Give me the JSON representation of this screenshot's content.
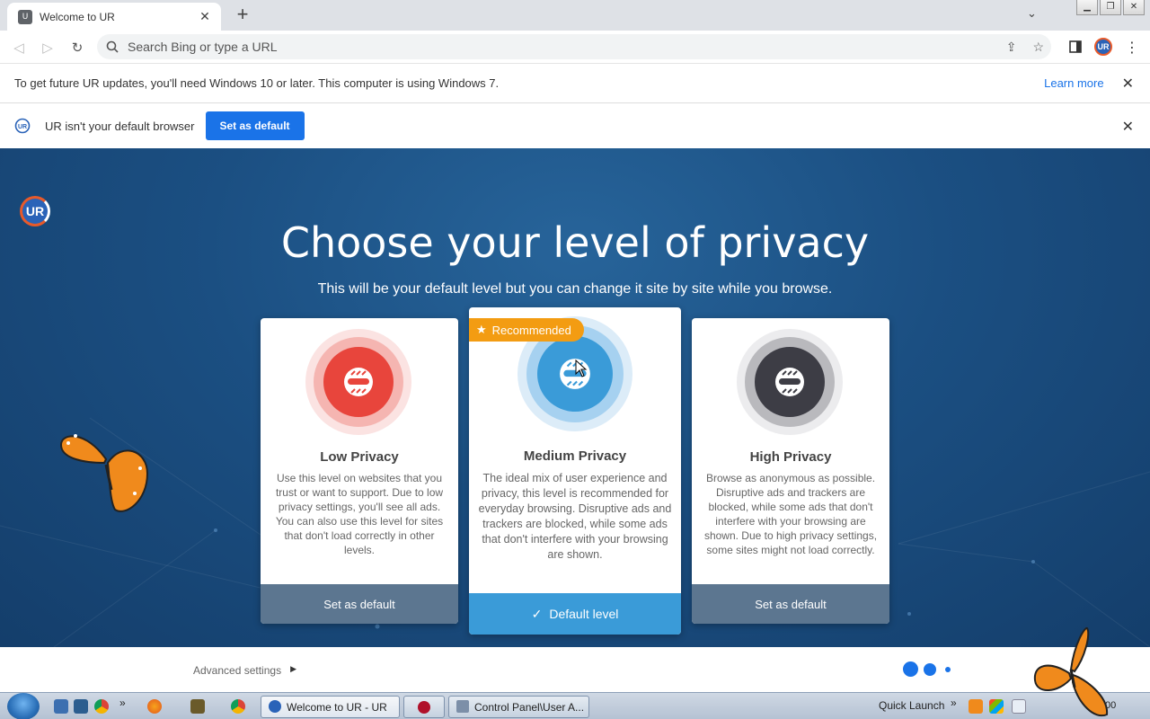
{
  "browser": {
    "tab_title": "Welcome to UR",
    "tab_favicon": "U",
    "omnibox_placeholder": "Search Bing or type a URL",
    "avatar_label": "UR"
  },
  "infobar_update": {
    "message": "To get future UR updates, you'll need Windows 10 or later. This computer is using Windows 7.",
    "learn_more": "Learn more"
  },
  "infobar_default": {
    "message": "UR isn't your default browser",
    "button": "Set as default"
  },
  "page": {
    "logo": "UR",
    "title": "Choose your level of privacy",
    "subtitle": "This will be your default level but you can change it site by site while you browse.",
    "cards": [
      {
        "title": "Low Privacy",
        "description": "Use this level on websites that you trust or want to support. Due to low privacy settings, you'll see all ads. You can also use this level for sites that don't load correctly in other levels.",
        "button": "Set as default",
        "color": "#e8453c"
      },
      {
        "badge": "Recommended",
        "title": "Medium Privacy",
        "description": "The ideal mix of user experience and privacy, this level is recommended for everyday browsing. Disruptive ads and trackers are blocked, while some ads that don't interfere with your browsing are shown.",
        "button": "Default level",
        "color": "#3a9bd8"
      },
      {
        "title": "High Privacy",
        "description": "Browse as anonymous as possible. Disruptive ads and trackers are blocked, while some ads that don't interfere with your browsing are shown. Due to high privacy settings, some sites might not load correctly.",
        "button": "Set as default",
        "color": "#3d3d45"
      }
    ],
    "advanced_settings": "Advanced settings"
  },
  "taskbar": {
    "tasks": [
      {
        "label": "Welcome to UR - UR"
      },
      {
        "label": "Control Panel\\User A..."
      }
    ],
    "quick_launch": "Quick Launch",
    "chevron": "»",
    "clock": "00"
  }
}
